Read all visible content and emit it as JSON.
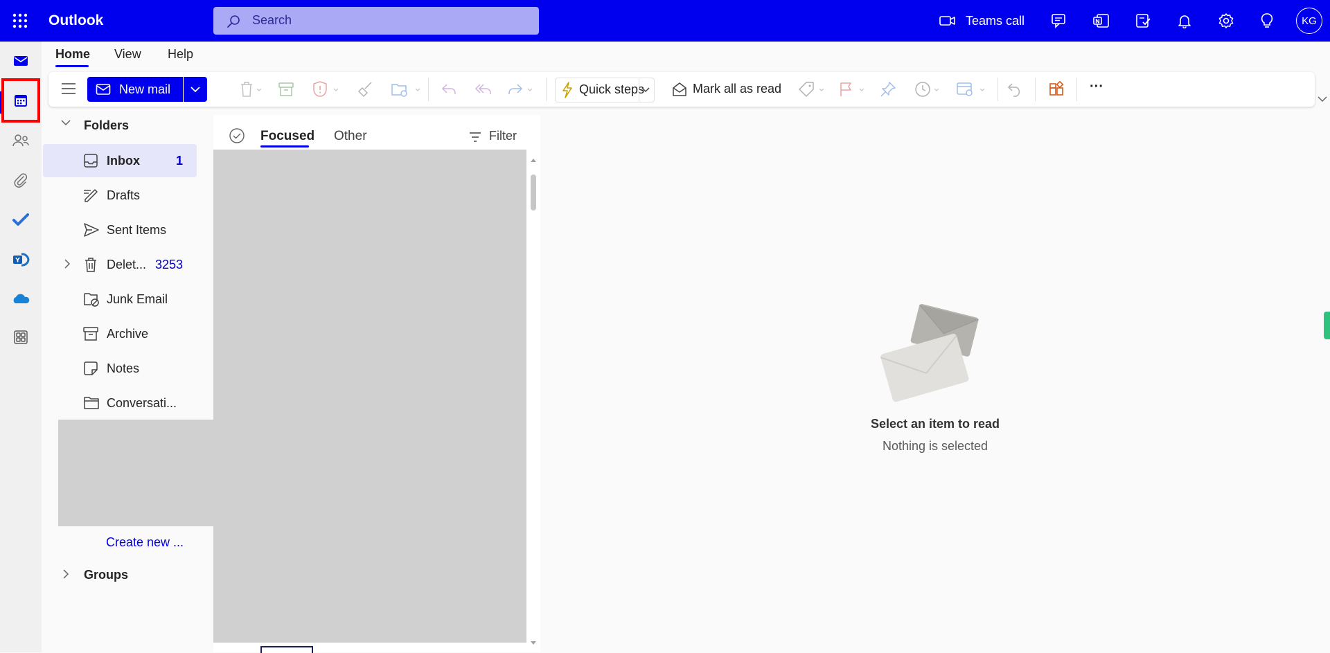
{
  "app": {
    "title": "Outlook"
  },
  "search": {
    "placeholder": "Search"
  },
  "topbar": {
    "teams_call_label": "Teams call",
    "avatar_initials": "KG",
    "background_color": "#0000ee"
  },
  "ribbon": {
    "tabs": [
      "Home",
      "View",
      "Help"
    ],
    "new_mail_label": "New mail",
    "quick_steps_label": "Quick steps",
    "mark_all_read_label": "Mark all as read",
    "more_label": "···"
  },
  "folders": {
    "header": "Folders",
    "items": [
      {
        "label": "Inbox",
        "count": "1",
        "icon": "inbox-icon"
      },
      {
        "label": "Drafts",
        "count": "",
        "icon": "drafts-icon"
      },
      {
        "label": "Sent Items",
        "count": "",
        "icon": "send-icon"
      },
      {
        "label": "Delet...",
        "count": "3253",
        "icon": "trash-icon"
      },
      {
        "label": "Junk Email",
        "count": "",
        "icon": "junk-icon"
      },
      {
        "label": "Archive",
        "count": "",
        "icon": "archive-icon"
      },
      {
        "label": "Notes",
        "count": "",
        "icon": "notes-icon"
      },
      {
        "label": "Conversati...",
        "count": "",
        "icon": "folder-icon"
      }
    ],
    "create_new": "Create new ...",
    "groups": "Groups"
  },
  "message_list": {
    "tab_focused": "Focused",
    "tab_other": "Other",
    "filter_label": "Filter"
  },
  "reading_pane": {
    "empty_title": "Select an item to read",
    "empty_subtitle": "Nothing is selected"
  }
}
